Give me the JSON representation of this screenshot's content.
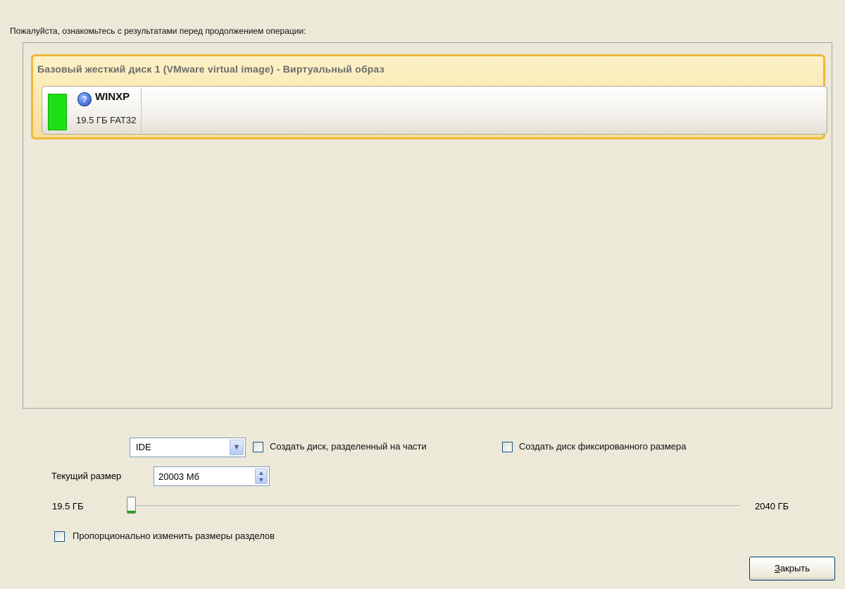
{
  "intro_text": "Пожалуйста, ознакомьтесь с результатами перед продолжением операции:",
  "disk": {
    "title": "Базовый жесткий диск 1 (VMware virtual image) - Виртуальный образ",
    "partition": {
      "name": "WINXP",
      "size_fs": "19.5 ГБ FAT32",
      "color": "#1ee014",
      "icon": "question-icon"
    }
  },
  "controls": {
    "interface_select": {
      "value": "IDE"
    },
    "split_disk_checkbox": {
      "label": "Создать диск, разделенный на части",
      "checked": false
    },
    "fixed_size_checkbox": {
      "label": "Создать диск фиксированного размера",
      "checked": false
    },
    "current_size": {
      "label": "Текущий размер",
      "value": "20003 Мб"
    },
    "size_slider": {
      "min_label": "19.5 ГБ",
      "max_label": "2040 ГБ",
      "position_fraction": 0.0
    },
    "proportional_checkbox": {
      "label": "Пропорционально изменить размеры разделов",
      "checked": false
    }
  },
  "buttons": {
    "close_mnemonic": "З",
    "close_rest": "акрыть"
  }
}
